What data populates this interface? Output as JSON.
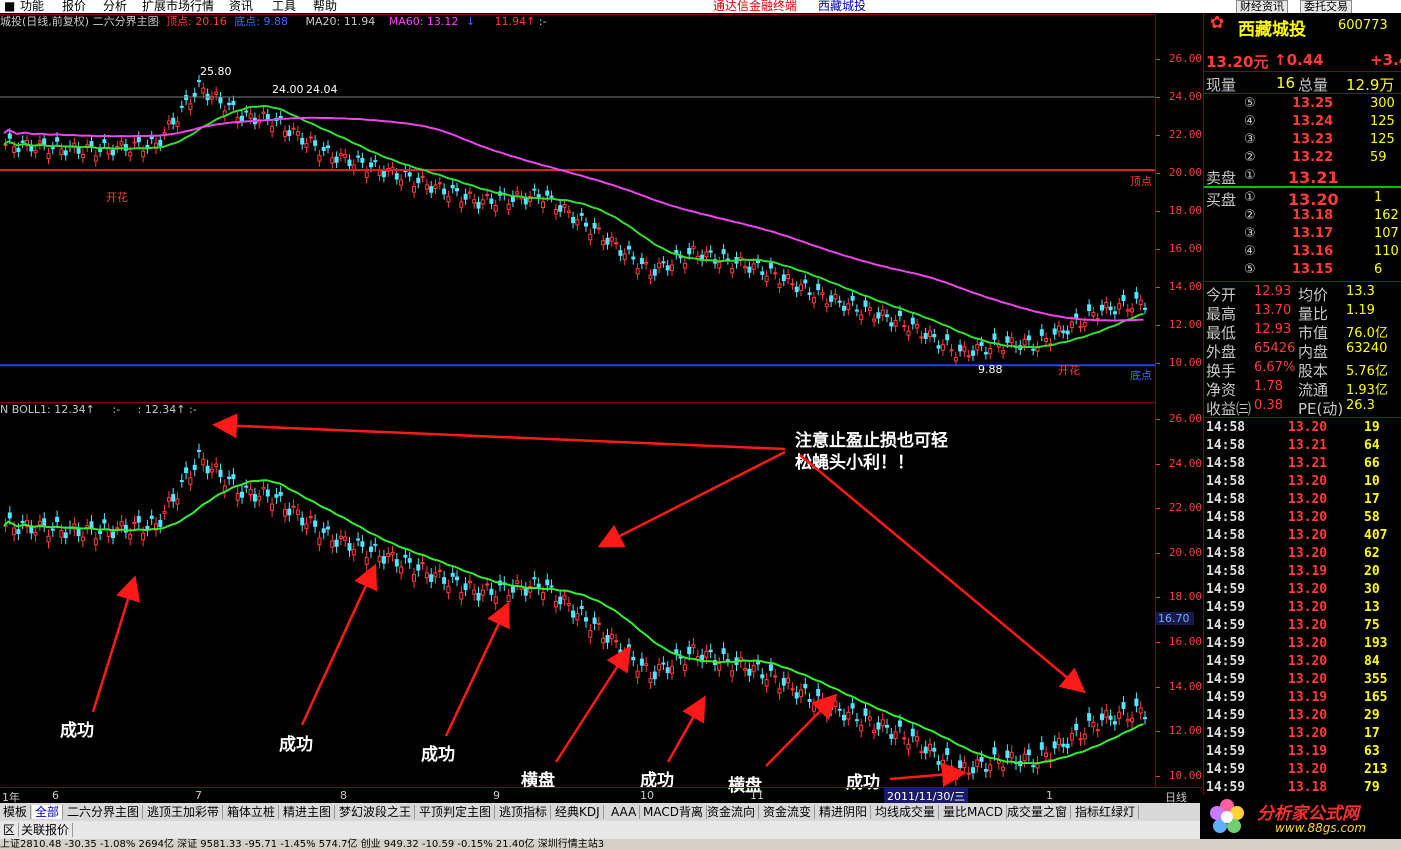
{
  "menu": {
    "items": [
      "功能",
      "报价",
      "分析",
      "扩展市场行情",
      "资讯",
      "工具",
      "帮助"
    ],
    "ad": "通达信金融终端",
    "stock_title": "西藏城投",
    "btn_news": "财经资讯",
    "btn_trade": "委托交易"
  },
  "main_chart": {
    "header": [
      "城投(日线,前复权) 二六分界主图",
      "顶点: 20.16",
      "底点: 9.88",
      "MA20: 11.94",
      "MA60: 13.12",
      "↓",
      "11.94↑",
      ":-"
    ],
    "y_ticks": [
      "26.00",
      "24.00",
      "22.00",
      "20.00",
      "18.00",
      "16.00",
      "14.00",
      "12.00",
      "10.00"
    ],
    "labels": {
      "high": "25.80",
      "peak": "24.00",
      "peak2": "24.04",
      "low": "9.88",
      "top": "顶点",
      "bottom": "底点",
      "kaihua": "开花"
    }
  },
  "sub_chart": {
    "header": [
      "N BOLL1: 12.34↑",
      ":-",
      ": 12.34↑",
      ":-"
    ],
    "y_ticks": [
      "26.00",
      "24.00",
      "22.00",
      "20.00",
      "18.00",
      "16.00",
      "14.00",
      "12.00",
      "10.00"
    ],
    "cursor_value": "16.70"
  },
  "annotations": {
    "note_line1": "注意止盈止损也可轻",
    "note_line2": "松蝇头小利！！",
    "items": [
      "成功",
      "成功",
      "成功",
      "横盘",
      "成功",
      "横盘",
      "成功"
    ]
  },
  "date_axis": {
    "labels": [
      "1年",
      "6",
      "7",
      "8",
      "9",
      "10",
      "11",
      "1"
    ],
    "cursor": "2011/11/30/三",
    "period": "日线"
  },
  "quote": {
    "name": "西藏城投",
    "code": "600773",
    "price": "13.20元",
    "change": "↑0.44",
    "pct": "+3.4",
    "xianliang_label": "现量",
    "xianliang": "16",
    "zongliang_label": "总量",
    "zongliang": "12.9万",
    "asks": [
      {
        "lvl": "⑤",
        "price": "13.25",
        "vol": "300"
      },
      {
        "lvl": "④",
        "price": "13.24",
        "vol": "125"
      },
      {
        "lvl": "③",
        "price": "13.23",
        "vol": "125"
      },
      {
        "lvl": "②",
        "price": "13.22",
        "vol": "59"
      },
      {
        "lvl": "①",
        "price": "13.21",
        "vol": ""
      }
    ],
    "ask_label": "卖盘",
    "bid_label": "买盘",
    "bids": [
      {
        "lvl": "①",
        "price": "13.20",
        "vol": "1"
      },
      {
        "lvl": "②",
        "price": "13.18",
        "vol": "162"
      },
      {
        "lvl": "③",
        "price": "13.17",
        "vol": "107"
      },
      {
        "lvl": "④",
        "price": "13.16",
        "vol": "110"
      },
      {
        "lvl": "⑤",
        "price": "13.15",
        "vol": "6"
      }
    ],
    "stats": [
      {
        "l1": "今开",
        "v1": "12.93",
        "l2": "均价",
        "v2": "13.3"
      },
      {
        "l1": "最高",
        "v1": "13.70",
        "l2": "量比",
        "v2": "1.19"
      },
      {
        "l1": "最低",
        "v1": "12.93",
        "l2": "市值",
        "v2": "76.0亿"
      },
      {
        "l1": "外盘",
        "v1": "65426",
        "l2": "内盘",
        "v2": "63240"
      },
      {
        "l1": "换手",
        "v1": "6.67%",
        "l2": "股本",
        "v2": "5.76亿"
      },
      {
        "l1": "净资",
        "v1": "1.78",
        "l2": "流通",
        "v2": "1.93亿"
      },
      {
        "l1": "收益㈢",
        "v1": "0.38",
        "l2": "PE(动)",
        "v2": "26.3"
      }
    ],
    "ticks": [
      {
        "t": "14:58",
        "p": "13.20",
        "v": "19"
      },
      {
        "t": "14:58",
        "p": "13.21",
        "v": "64"
      },
      {
        "t": "14:58",
        "p": "13.21",
        "v": "66"
      },
      {
        "t": "14:58",
        "p": "13.20",
        "v": "10"
      },
      {
        "t": "14:58",
        "p": "13.20",
        "v": "17"
      },
      {
        "t": "14:58",
        "p": "13.20",
        "v": "58"
      },
      {
        "t": "14:58",
        "p": "13.20",
        "v": "407"
      },
      {
        "t": "14:58",
        "p": "13.20",
        "v": "62"
      },
      {
        "t": "14:58",
        "p": "13.19",
        "v": "20"
      },
      {
        "t": "14:59",
        "p": "13.20",
        "v": "30"
      },
      {
        "t": "14:59",
        "p": "13.20",
        "v": "13"
      },
      {
        "t": "14:59",
        "p": "13.20",
        "v": "75"
      },
      {
        "t": "14:59",
        "p": "13.20",
        "v": "193"
      },
      {
        "t": "14:59",
        "p": "13.20",
        "v": "84"
      },
      {
        "t": "14:59",
        "p": "13.20",
        "v": "355"
      },
      {
        "t": "14:59",
        "p": "13.19",
        "v": "165"
      },
      {
        "t": "14:59",
        "p": "13.20",
        "v": "29"
      },
      {
        "t": "14:59",
        "p": "13.20",
        "v": "17"
      },
      {
        "t": "14:59",
        "p": "13.19",
        "v": "63"
      },
      {
        "t": "14:59",
        "p": "13.20",
        "v": "213"
      },
      {
        "t": "14:59",
        "p": "13.18",
        "v": "79"
      }
    ]
  },
  "tabs": [
    "模板",
    "全部",
    "二六分界主图",
    "逃顶王加彩带",
    "箱体立桩",
    "精进主图",
    "梦幻波段之王",
    "平顶判定主图",
    "逃顶指标",
    "经典KDJ",
    "AAA",
    "MACD背离",
    "资金流向",
    "资金流变",
    "精进阴阳",
    "均线成交量",
    "量比MACD",
    "成交量之窗",
    "指标红绿灯"
  ],
  "bottom_tabs": [
    "区",
    "关联报价"
  ],
  "status_bar": "上证2810.48 -30.35 -1.08%  2694亿 深证 9581.33 -95.71 -1.45%  574.7亿 创业 949.32 -10.59 -0.15%  21.40亿  深圳行情主站3",
  "logo": {
    "text": "分析家公式网",
    "url": "www.88gs.com"
  }
}
